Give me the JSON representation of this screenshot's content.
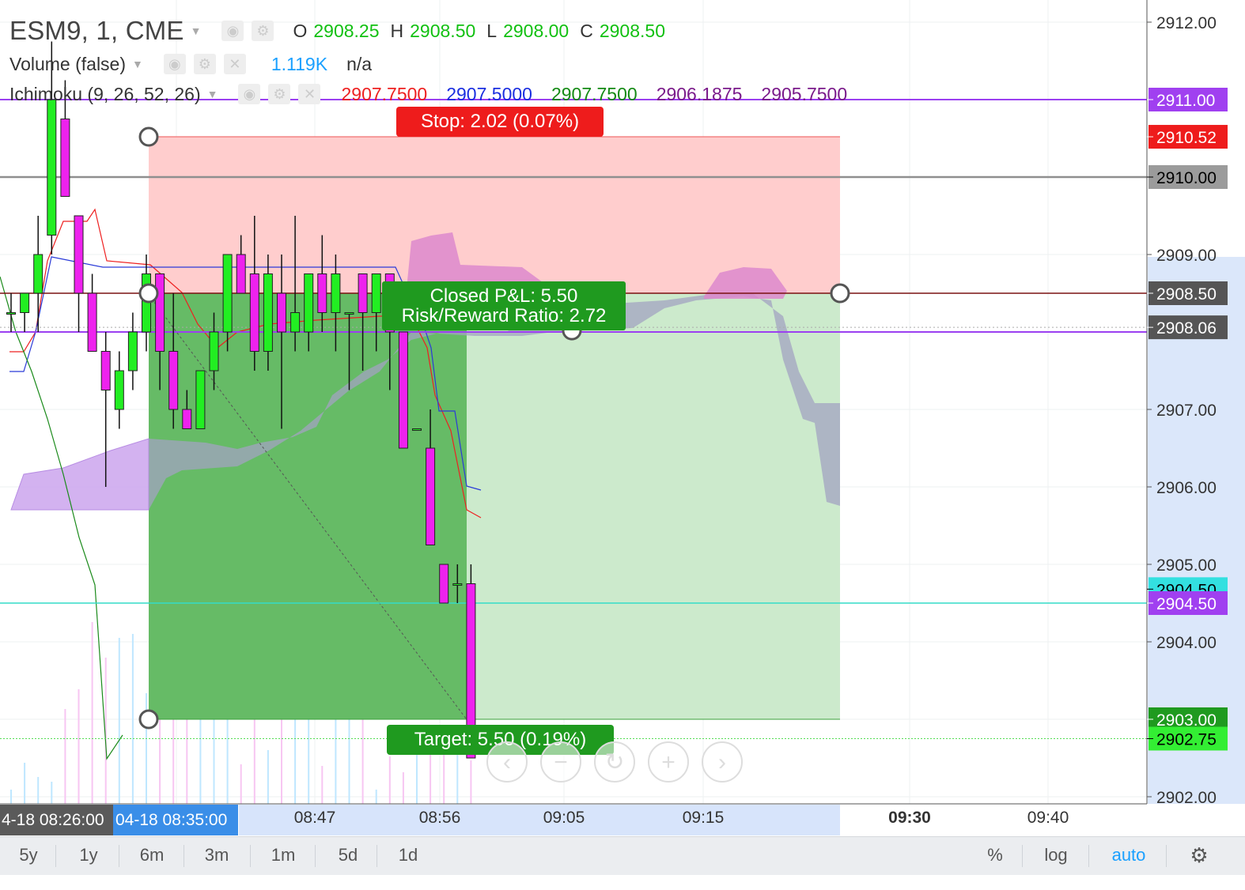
{
  "symbol_title": "ESM9, 1, CME",
  "ohlc": {
    "o_label": "O",
    "o": "2908.25",
    "h_label": "H",
    "h": "2908.50",
    "l_label": "L",
    "l": "2908.00",
    "c_label": "C",
    "c": "2908.50"
  },
  "volume_indicator": {
    "label": "Volume (false)",
    "value": "1.119K",
    "extra": "n/a"
  },
  "ichimoku_indicator": {
    "label": "Ichimoku (9, 26, 52, 26)",
    "values": [
      {
        "text": "2907.7500",
        "color": "#ee2020"
      },
      {
        "text": "2907.5000",
        "color": "#1a2ee0"
      },
      {
        "text": "2907.7500",
        "color": "#148a14"
      },
      {
        "text": "2906.1875",
        "color": "#7a1a8a"
      },
      {
        "text": "2905.7500",
        "color": "#7a1a8a"
      }
    ]
  },
  "position_tool": {
    "stop_label": "Stop: 2.02 (0.07%)",
    "target_label": "Target: 5.50 (0.19%)",
    "pl_line1": "Closed P&L: 5.50",
    "pl_line2": "Risk/Reward Ratio: 2.72",
    "entry": 2908.5,
    "stop": 2910.52,
    "target": 2903.0,
    "exit": 2908.06
  },
  "chart_data": {
    "type": "candlestick",
    "ylim": [
      2902.0,
      2912.0
    ],
    "y_ticks": [
      "2912.00",
      "2909.00",
      "2907.00",
      "2906.00",
      "2905.00",
      "2904.00",
      "2902.00"
    ],
    "x_ticks": [
      "08:47",
      "08:56",
      "09:05",
      "09:15",
      "09:30",
      "09:40"
    ],
    "x_range_labels": [
      "4-18 08:26:00",
      "04-18 08:35:00"
    ],
    "price_labels": [
      {
        "text": "2911.00",
        "value": 2911.0,
        "bg": "#a040f0",
        "fg": "#ffffff"
      },
      {
        "text": "2910.52",
        "value": 2910.52,
        "bg": "#ee1c1c",
        "fg": "#ffffff"
      },
      {
        "text": "2910.00",
        "value": 2910.0,
        "bg": "#9b9b9b",
        "fg": "#000000"
      },
      {
        "text": "2908.50",
        "value": 2908.5,
        "bg": "#555555",
        "fg": "#ffffff"
      },
      {
        "text": "2908.06",
        "value": 2908.06,
        "bg": "#555555",
        "fg": "#ffffff"
      },
      {
        "text": "2904.50",
        "value": 2904.68,
        "bg": "#33e0e0",
        "fg": "#000000"
      },
      {
        "text": "2904.50",
        "value": 2904.5,
        "bg": "#a040f0",
        "fg": "#ffffff"
      },
      {
        "text": "2903.00",
        "value": 2903.0,
        "bg": "#1f9a1f",
        "fg": "#ffffff"
      },
      {
        "text": "2902.75",
        "value": 2902.75,
        "bg": "#33ee33",
        "fg": "#000000"
      }
    ],
    "candles": [
      {
        "o": 2908.25,
        "h": 2908.5,
        "l": 2908.0,
        "c": 2908.25
      },
      {
        "o": 2908.25,
        "h": 2908.5,
        "l": 2908.0,
        "c": 2908.5
      },
      {
        "o": 2908.5,
        "h": 2909.5,
        "l": 2908.0,
        "c": 2909.0
      },
      {
        "o": 2909.25,
        "h": 2911.75,
        "l": 2909.0,
        "c": 2911.0
      },
      {
        "o": 2910.75,
        "h": 2911.25,
        "l": 2909.75,
        "c": 2909.75
      },
      {
        "o": 2909.5,
        "h": 2909.5,
        "l": 2908.0,
        "c": 2908.5
      },
      {
        "o": 2908.5,
        "h": 2908.75,
        "l": 2907.75,
        "c": 2907.75
      },
      {
        "o": 2907.75,
        "h": 2908.0,
        "l": 2906.0,
        "c": 2907.25
      },
      {
        "o": 2907.0,
        "h": 2907.75,
        "l": 2906.75,
        "c": 2907.5
      },
      {
        "o": 2907.5,
        "h": 2908.25,
        "l": 2907.25,
        "c": 2908.0
      },
      {
        "o": 2908.0,
        "h": 2909.0,
        "l": 2907.75,
        "c": 2908.75
      },
      {
        "o": 2908.75,
        "h": 2908.75,
        "l": 2907.25,
        "c": 2907.75
      },
      {
        "o": 2907.75,
        "h": 2908.5,
        "l": 2906.75,
        "c": 2907.0
      },
      {
        "o": 2907.0,
        "h": 2907.25,
        "l": 2906.75,
        "c": 2906.75
      },
      {
        "o": 2906.75,
        "h": 2907.5,
        "l": 2906.75,
        "c": 2907.5
      },
      {
        "o": 2907.5,
        "h": 2908.25,
        "l": 2907.25,
        "c": 2908.0
      },
      {
        "o": 2908.0,
        "h": 2909.0,
        "l": 2907.75,
        "c": 2909.0
      },
      {
        "o": 2909.0,
        "h": 2909.25,
        "l": 2908.5,
        "c": 2908.5
      },
      {
        "o": 2908.75,
        "h": 2909.5,
        "l": 2907.5,
        "c": 2907.75
      },
      {
        "o": 2907.75,
        "h": 2909.0,
        "l": 2907.5,
        "c": 2908.75
      },
      {
        "o": 2908.5,
        "h": 2909.0,
        "l": 2906.75,
        "c": 2908.0
      },
      {
        "o": 2908.0,
        "h": 2909.5,
        "l": 2907.75,
        "c": 2908.25
      },
      {
        "o": 2908.0,
        "h": 2908.75,
        "l": 2907.75,
        "c": 2908.75
      },
      {
        "o": 2908.75,
        "h": 2909.25,
        "l": 2908.0,
        "c": 2908.25
      },
      {
        "o": 2908.25,
        "h": 2909.0,
        "l": 2907.75,
        "c": 2908.75
      },
      {
        "o": 2908.25,
        "h": 2908.25,
        "l": 2907.25,
        "c": 2908.25
      },
      {
        "o": 2908.75,
        "h": 2908.75,
        "l": 2907.5,
        "c": 2908.25
      },
      {
        "o": 2908.25,
        "h": 2908.75,
        "l": 2907.75,
        "c": 2908.75
      },
      {
        "o": 2908.75,
        "h": 2908.75,
        "l": 2907.25,
        "c": 2908.0
      },
      {
        "o": 2908.0,
        "h": 2908.0,
        "l": 2906.5,
        "c": 2906.5
      },
      {
        "o": 2906.75,
        "h": 2906.75,
        "l": 2906.75,
        "c": 2906.75
      },
      {
        "o": 2906.5,
        "h": 2907.0,
        "l": 2905.25,
        "c": 2905.25
      },
      {
        "o": 2905.0,
        "h": 2905.0,
        "l": 2904.5,
        "c": 2904.5
      },
      {
        "o": 2904.75,
        "h": 2905.0,
        "l": 2904.5,
        "c": 2904.75
      },
      {
        "o": 2904.75,
        "h": 2905.0,
        "l": 2902.5,
        "c": 2902.5
      }
    ]
  },
  "time_ranges": [
    "5y",
    "1y",
    "6m",
    "3m",
    "1m",
    "5d",
    "1d"
  ],
  "toolbar_right": {
    "percent": "%",
    "log": "log",
    "auto": "auto"
  },
  "colors": {
    "up": "#22ee22",
    "down": "#ee22ee",
    "wick": "#111111",
    "stop_zone": "#ffcdcd",
    "target_zone": "#cceacc",
    "closed_zone": "#66bb66",
    "cloud_bull": "#cfaaef",
    "cloud_bear": "#a3a3c2",
    "accent_auto": "#1aa0ff"
  }
}
